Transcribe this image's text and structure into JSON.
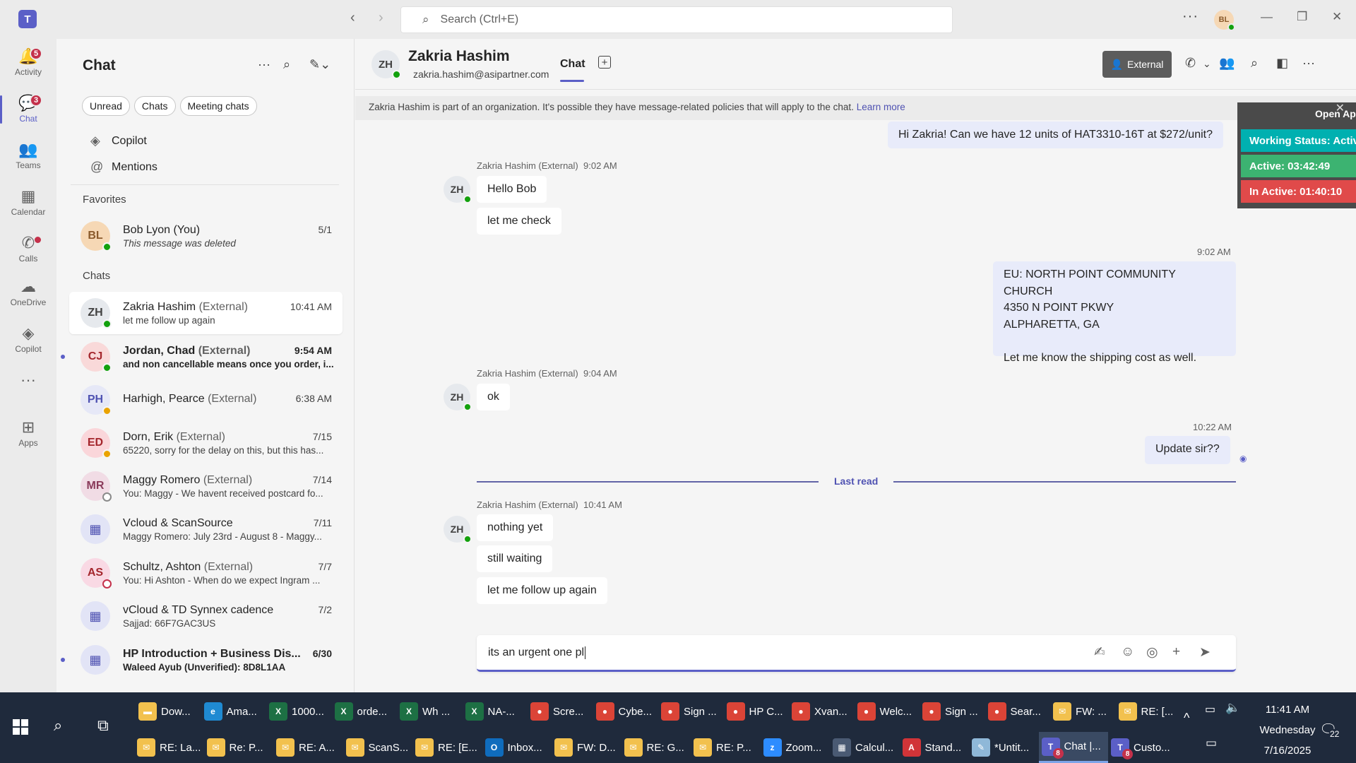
{
  "titlebar": {
    "app_logo": "T",
    "search_placeholder": "Search (Ctrl+E)",
    "more": "···",
    "avatar_initials": "BL"
  },
  "rail": {
    "items": [
      {
        "label": "Activity",
        "icon": "bell-icon",
        "glyph": "🔔",
        "badge": "5"
      },
      {
        "label": "Chat",
        "icon": "chat-icon",
        "glyph": "💬",
        "badge": "3"
      },
      {
        "label": "Teams",
        "icon": "teams-icon",
        "glyph": "👥"
      },
      {
        "label": "Calendar",
        "icon": "calendar-icon",
        "glyph": "▦"
      },
      {
        "label": "Calls",
        "icon": "phone-icon",
        "glyph": "✆"
      },
      {
        "label": "OneDrive",
        "icon": "cloud-icon",
        "glyph": "☁"
      },
      {
        "label": "Copilot",
        "icon": "copilot-icon",
        "glyph": "◈"
      },
      {
        "label": "",
        "icon": "more-apps-icon",
        "glyph": "···"
      },
      {
        "label": "Apps",
        "icon": "apps-icon",
        "glyph": "⊞"
      }
    ]
  },
  "chatlist": {
    "title": "Chat",
    "filters": [
      "Unread",
      "Chats",
      "Meeting chats"
    ],
    "links": [
      "Copilot",
      "Mentions"
    ],
    "favorites_label": "Favorites",
    "chats_label": "Chats",
    "favorite": {
      "initials": "BL",
      "name": "Bob Lyon (You)",
      "preview": "This message was deleted",
      "time": "5/1",
      "color": "#f6d8b5",
      "text_color": "#8a5a2b"
    },
    "chats": [
      {
        "initials": "ZH",
        "name": "Zakria Hashim",
        "ext": "(External)",
        "preview": "let me follow up again",
        "time": "10:41 AM",
        "color": "#e6e9ed",
        "text_color": "#424242",
        "presence": "available"
      },
      {
        "initials": "CJ",
        "name": "Jordan, Chad",
        "ext": "(External)",
        "preview": "and non cancellable means once you order, i...",
        "time": "9:54 AM",
        "color": "#f9d9d9",
        "text_color": "#a4262c",
        "presence": "available"
      },
      {
        "initials": "PH",
        "name": "Harhigh, Pearce",
        "ext": "(External)",
        "preview": "",
        "time": "6:38 AM",
        "color": "#e6e8f7",
        "text_color": "#4f52b2",
        "presence": "away"
      },
      {
        "initials": "ED",
        "name": "Dorn, Erik",
        "ext": "(External)",
        "preview": "65220, sorry for the delay on this, but this has...",
        "time": "7/15",
        "color": "#fad6da",
        "text_color": "#a4262c",
        "presence": "away"
      },
      {
        "initials": "MR",
        "name": "Maggy Romero",
        "ext": "(External)",
        "preview": "You: Maggy - We havent received postcard fo...",
        "time": "7/14",
        "color": "#f1dce5",
        "text_color": "#8a3a5a",
        "presence": "offline"
      },
      {
        "initials": "",
        "name": "Vcloud & ScanSource",
        "ext": "",
        "preview": "Maggy Romero: July 23rd - August 8 - Maggy...",
        "time": "7/11",
        "color": "#e2e4f6",
        "text_color": "#4f52b2",
        "presence": ""
      },
      {
        "initials": "AS",
        "name": "Schultz, Ashton",
        "ext": "(External)",
        "preview": "You: Hi Ashton -  When do we expect Ingram ...",
        "time": "7/7",
        "color": "#f9d9e4",
        "text_color": "#a4262c",
        "presence": "dnd"
      },
      {
        "initials": "",
        "name": "vCloud & TD Synnex cadence",
        "ext": "",
        "preview": "Sajjad: 66F7GAC3US",
        "time": "7/2",
        "color": "#e2e4f6",
        "text_color": "#4f52b2",
        "presence": ""
      },
      {
        "initials": "",
        "name": "HP Introduction + Business Dis...",
        "ext": "",
        "preview": "Waleed Ayub (Unverified): 8D8L1AA",
        "time": "6/30",
        "color": "#e2e4f6",
        "text_color": "#4f52b2",
        "presence": ""
      }
    ]
  },
  "conversation": {
    "contact_initials": "ZH",
    "contact_name": "Zakria Hashim",
    "contact_email": "zakria.hashim@asipartner.com",
    "tab": "Chat",
    "external_label": "External",
    "banner_text": "Zakria Hashim is part of an organization. It's possible they have message-related policies that will apply to the chat.",
    "banner_link": "Learn more",
    "msg_out_1": "Hi Zakria! Can we have 12 units of HAT3310-16T at $272/unit?",
    "group1_sender": "Zakria Hashim (External)",
    "group1_time": "9:02 AM",
    "group1_msgs": [
      "Hello Bob",
      "let me check"
    ],
    "out2_time": "9:02 AM",
    "out2_lines": [
      "EU: NORTH POINT COMMUNITY CHURCH",
      "4350 N POINT PKWY",
      "ALPHARETTA, GA",
      "",
      "Let me know the shipping cost as well."
    ],
    "group2_sender": "Zakria Hashim (External)",
    "group2_time": "9:04 AM",
    "group2_msgs": [
      "ok"
    ],
    "out3_time": "10:22 AM",
    "out3_text": "Update sir??",
    "last_read": "Last read",
    "group3_sender": "Zakria Hashim (External)",
    "group3_time": "10:41 AM",
    "group3_msgs": [
      "nothing yet",
      "still waiting",
      "let me follow up again"
    ],
    "composer_text": "its an urgent one pl"
  },
  "widget": {
    "open_label": "Open Ap",
    "working_status": "Working Status: Activ",
    "active": "Active: 03:42:49",
    "inactive": "In Active: 01:40:10",
    "colors": {
      "working": "#00b0b0",
      "active": "#3cb371",
      "inactive": "#e04a4a"
    }
  },
  "taskbar": {
    "row1": [
      {
        "label": "Dow...",
        "icon": "folder-icon",
        "color": "#f2c14e",
        "glyph": "▬"
      },
      {
        "label": "Ama...",
        "icon": "edge-icon",
        "color": "#1f8ad2",
        "glyph": "e"
      },
      {
        "label": "1000...",
        "icon": "excel-icon",
        "color": "#1d7044",
        "glyph": "X"
      },
      {
        "label": "orde...",
        "icon": "excel-icon",
        "color": "#1d7044",
        "glyph": "X"
      },
      {
        "label": "Wh ...",
        "icon": "excel-icon",
        "color": "#1d7044",
        "glyph": "X"
      },
      {
        "label": "NA-...",
        "icon": "excel-icon",
        "color": "#1d7044",
        "glyph": "X"
      },
      {
        "label": "Scre...",
        "icon": "chrome-icon",
        "color": "#db4437",
        "glyph": "●"
      },
      {
        "label": "Cybe...",
        "icon": "chrome-icon",
        "color": "#db4437",
        "glyph": "●"
      },
      {
        "label": "Sign ...",
        "icon": "chrome-icon",
        "color": "#db4437",
        "glyph": "●"
      },
      {
        "label": "HP C...",
        "icon": "chrome-icon",
        "color": "#db4437",
        "glyph": "●"
      },
      {
        "label": "Xvan...",
        "icon": "chrome-icon",
        "color": "#db4437",
        "glyph": "●"
      },
      {
        "label": "Welc...",
        "icon": "chrome-icon",
        "color": "#db4437",
        "glyph": "●"
      },
      {
        "label": "Sign ...",
        "icon": "chrome-icon",
        "color": "#db4437",
        "glyph": "●"
      },
      {
        "label": "Sear...",
        "icon": "chrome-icon",
        "color": "#db4437",
        "glyph": "●"
      },
      {
        "label": "FW: ...",
        "icon": "mail-icon",
        "color": "#f2c14e",
        "glyph": "✉"
      },
      {
        "label": "RE: [...",
        "icon": "mail-icon",
        "color": "#f2c14e",
        "glyph": "✉"
      }
    ],
    "row2": [
      {
        "label": "RE: La...",
        "icon": "mail-icon",
        "color": "#f2c14e",
        "glyph": "✉"
      },
      {
        "label": "Re: P...",
        "icon": "mail-icon",
        "color": "#f2c14e",
        "glyph": "✉"
      },
      {
        "label": "RE: A...",
        "icon": "mail-icon",
        "color": "#f2c14e",
        "glyph": "✉"
      },
      {
        "label": "ScanS...",
        "icon": "mail-icon",
        "color": "#f2c14e",
        "glyph": "✉"
      },
      {
        "label": "RE: [E...",
        "icon": "mail-icon",
        "color": "#f2c14e",
        "glyph": "✉"
      },
      {
        "label": "Inbox...",
        "icon": "outlook-icon",
        "color": "#0f6cbd",
        "glyph": "O"
      },
      {
        "label": "FW: D...",
        "icon": "mail-icon",
        "color": "#f2c14e",
        "glyph": "✉"
      },
      {
        "label": "RE: G...",
        "icon": "mail-icon",
        "color": "#f2c14e",
        "glyph": "✉"
      },
      {
        "label": "RE: P...",
        "icon": "mail-icon",
        "color": "#f2c14e",
        "glyph": "✉"
      },
      {
        "label": "Zoom...",
        "icon": "zoom-icon",
        "color": "#2d8cff",
        "glyph": "z"
      },
      {
        "label": "Calcul...",
        "icon": "calculator-icon",
        "color": "#4a5a73",
        "glyph": "▦"
      },
      {
        "label": "Stand...",
        "icon": "pdf-icon",
        "color": "#d13438",
        "glyph": "A"
      },
      {
        "label": "*Untit...",
        "icon": "notepad-icon",
        "color": "#8fb8d8",
        "glyph": "✎"
      },
      {
        "label": "Chat |...",
        "icon": "teams-icon",
        "color": "#5b5fc7",
        "glyph": "T",
        "badge": "8"
      },
      {
        "label": "Custo...",
        "icon": "teams-icon",
        "color": "#5b5fc7",
        "glyph": "T",
        "badge": "8"
      }
    ],
    "time": "11:41 AM",
    "day": "Wednesday",
    "date": "7/16/2025",
    "notifications": "22"
  }
}
